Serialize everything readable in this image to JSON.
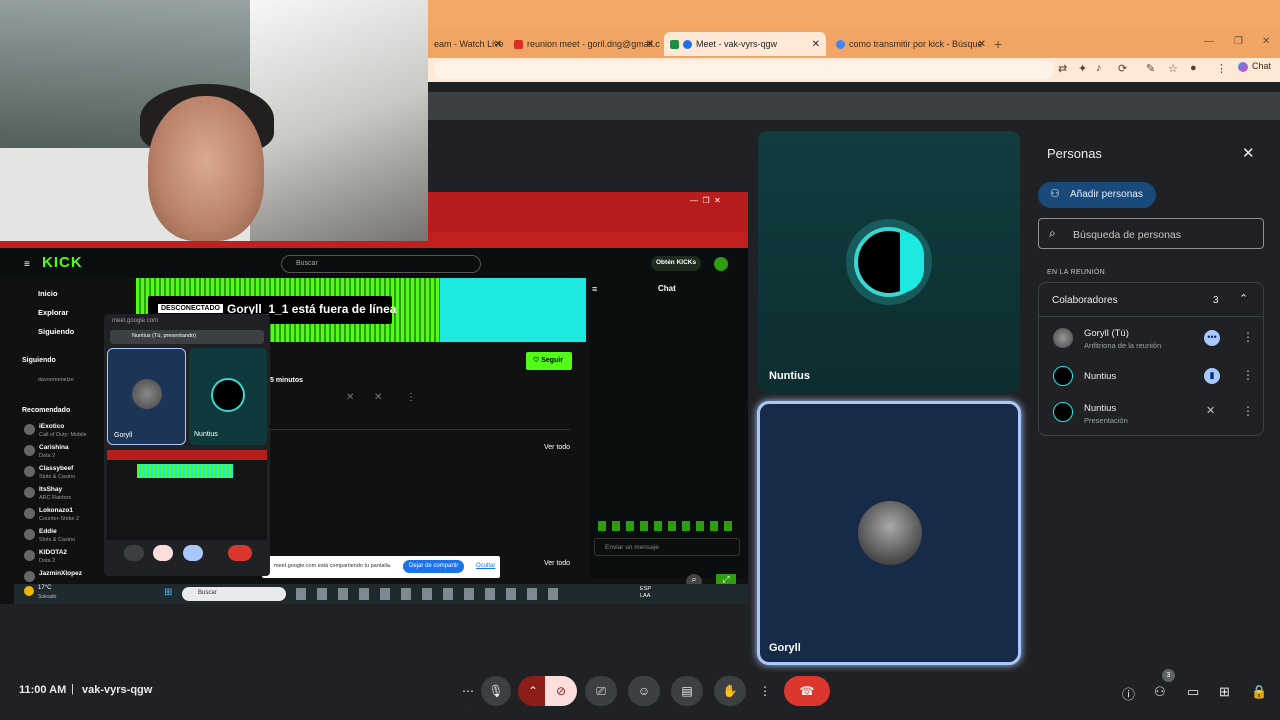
{
  "browser": {
    "tabs": [
      {
        "label": "eam - Watch Live",
        "active": false
      },
      {
        "label": "reunion meet - goril.dng@gmail.c",
        "active": false
      },
      {
        "label": "Meet - vak-vyrs-qgw",
        "active": true
      },
      {
        "label": "como transmitir por kick - Búsque",
        "active": false
      }
    ],
    "chat_button": "Chat"
  },
  "shared_screen": {
    "kick_logo": "KICK",
    "search_placeholder": "Buscar",
    "get_kicks": "Obtén KICKs",
    "nav": [
      "Inicio",
      "Explorar",
      "Siguiendo"
    ],
    "following_header": "Siguiendo",
    "following_user": "davoomenelze",
    "recommended_header": "Recomendado",
    "recommended": [
      {
        "name": "iExotico",
        "game": "Call of Duty: Mobile"
      },
      {
        "name": "Carishina",
        "game": "Dota 2"
      },
      {
        "name": "Classybeef",
        "game": "Slots & Casino"
      },
      {
        "name": "ItsShay",
        "game": "ARC Raiders"
      },
      {
        "name": "Lokonazo1",
        "game": "Counter-Strike 2"
      },
      {
        "name": "Eddie",
        "game": "Slots & Casino"
      },
      {
        "name": "KIDOTA2",
        "game": "Dota 2"
      },
      {
        "name": "JazminXlopez",
        "game": ""
      }
    ],
    "offline_badge": "DESCONECTADO",
    "offline_text": "Goryll_1_1 está fuera de línea",
    "follow": "Seguir",
    "minutes": "5 minutos",
    "see_all_1": "Ver todo",
    "see_all_2": "Ver todo",
    "chat_title": "Chat",
    "chat_placeholder": "Enviar un mensaje",
    "count": "47",
    "share_notice": "meet.google.com está compartiendo tu pantalla.",
    "stop_sharing": "Dejar de compartir",
    "hide": "Ocultar",
    "pip_url": "meet.google.com",
    "pip_presenter": "Nuntius (Tú, presentando)",
    "pip_tile_1": "Goryll",
    "pip_tile_2": "Nuntius",
    "weather_temp": "17°C",
    "weather_desc": "Soleado",
    "taskbar_search": "Buscar",
    "lang": "ESP\nLAA"
  },
  "tiles": [
    {
      "name": "Nuntius"
    },
    {
      "name": "Goryll"
    }
  ],
  "people_panel": {
    "title": "Personas",
    "add_people": "Añadir personas",
    "search_placeholder": "Búsqueda de personas",
    "section": "EN LA REUNIÓN",
    "group": "Colaboradores",
    "group_count": "3",
    "members": [
      {
        "name": "Goryll (Tú)",
        "role": "Anfitriona de la reunión"
      },
      {
        "name": "Nuntius",
        "role": ""
      },
      {
        "name": "Nuntius",
        "role": "Presentación"
      }
    ]
  },
  "bottom_bar": {
    "time": "11:00 AM",
    "separator": "|",
    "meeting_code": "vak-vyrs-qgw",
    "participants_badge": "3"
  },
  "colors": {
    "accent": "#a8c7fa",
    "end_call": "#dc362e",
    "kick_green": "#53fc18"
  }
}
